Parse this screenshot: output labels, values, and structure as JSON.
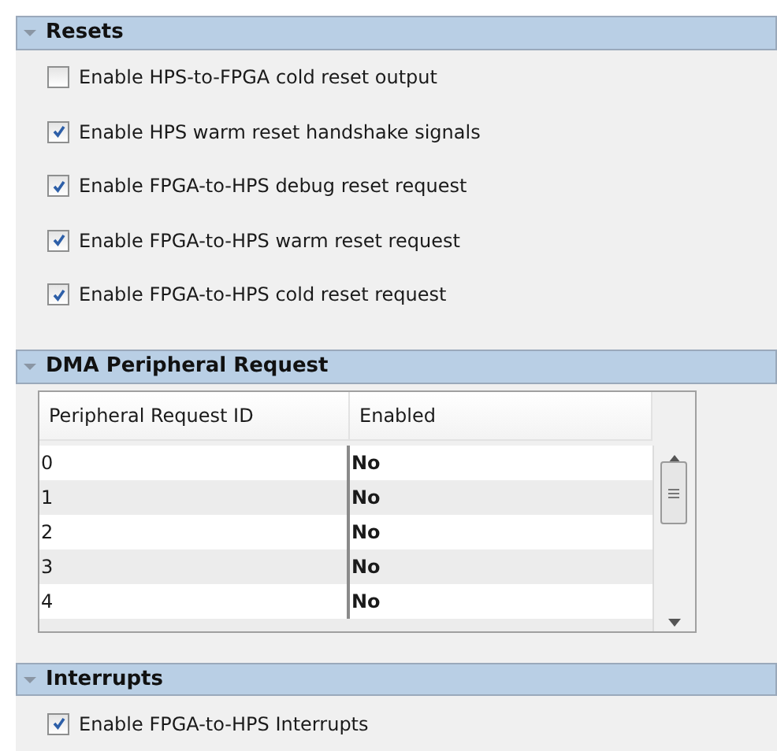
{
  "sections": [
    {
      "title": "Resets",
      "expanded": true,
      "kind": "checkboxes",
      "options": [
        {
          "label": "Enable HPS-to-FPGA cold reset output",
          "checked": false
        },
        {
          "label": "Enable HPS warm reset handshake signals",
          "checked": true
        },
        {
          "label": "Enable FPGA-to-HPS debug reset request",
          "checked": true
        },
        {
          "label": "Enable FPGA-to-HPS warm reset request",
          "checked": true
        },
        {
          "label": "Enable FPGA-to-HPS cold reset request",
          "checked": true
        }
      ]
    },
    {
      "title": "DMA Peripheral Request",
      "expanded": true,
      "kind": "table",
      "table": {
        "columns": [
          "Peripheral Request ID",
          "Enabled"
        ],
        "rows": [
          [
            "0",
            "No"
          ],
          [
            "1",
            "No"
          ],
          [
            "2",
            "No"
          ],
          [
            "3",
            "No"
          ],
          [
            "4",
            "No"
          ]
        ]
      }
    },
    {
      "title": "Interrupts",
      "expanded": true,
      "kind": "checkboxes",
      "options": [
        {
          "label": "Enable FPGA-to-HPS Interrupts",
          "checked": true
        }
      ]
    }
  ]
}
